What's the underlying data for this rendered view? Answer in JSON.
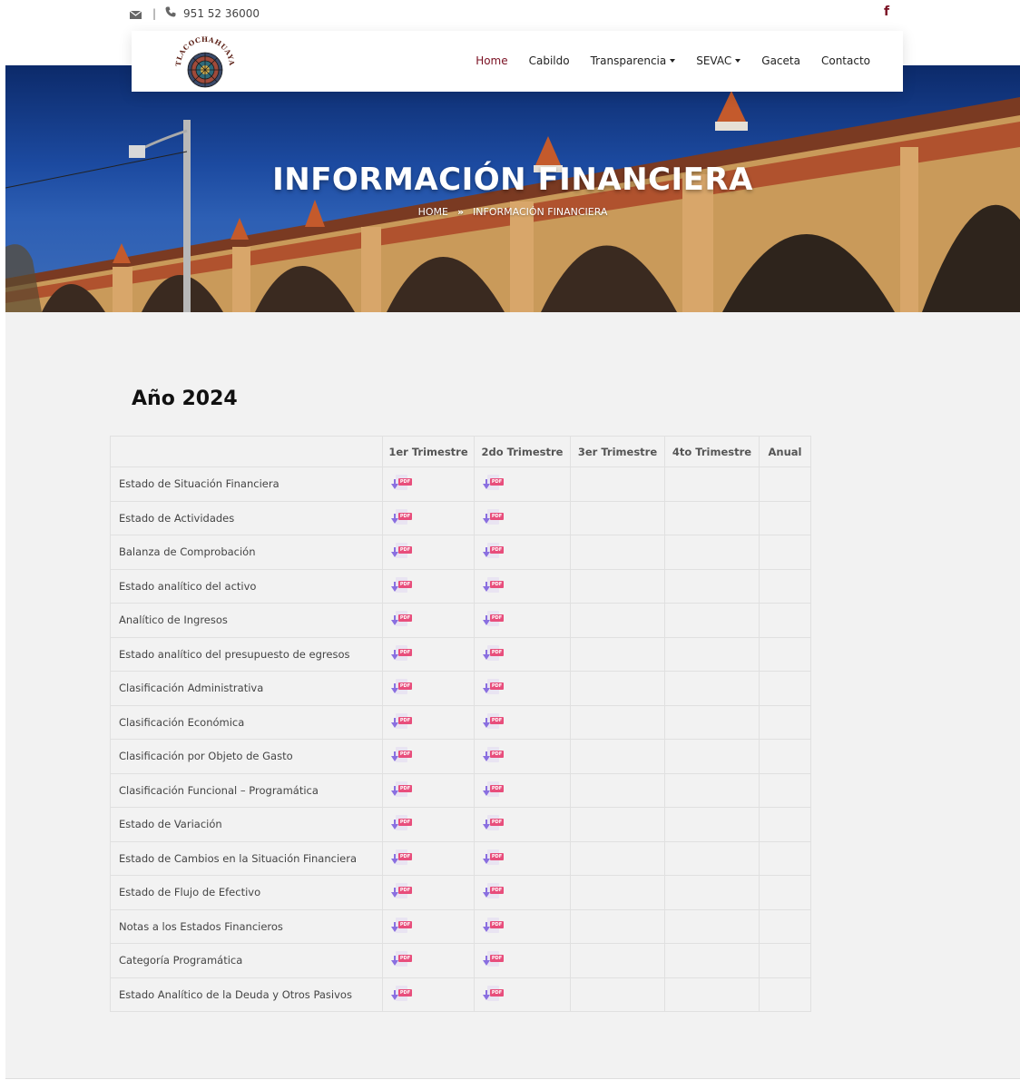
{
  "topbar": {
    "email_icon": "envelope-icon",
    "separator": "|",
    "phone_icon": "phone-icon",
    "phone": "951 52 36000",
    "social_icon": "facebook-icon",
    "social_glyph": "f"
  },
  "logo": {
    "alt_text": "TLACOCHAHUAYA"
  },
  "nav": {
    "items": [
      {
        "label": "Home",
        "active": true,
        "dropdown": false
      },
      {
        "label": "Cabildo",
        "active": false,
        "dropdown": false
      },
      {
        "label": "Transparencia",
        "active": false,
        "dropdown": true
      },
      {
        "label": "SEVAC",
        "active": false,
        "dropdown": true
      },
      {
        "label": "Gaceta",
        "active": false,
        "dropdown": false
      },
      {
        "label": "Contacto",
        "active": false,
        "dropdown": false
      }
    ]
  },
  "hero": {
    "title": "INFORMACIÓN FINANCIERA",
    "breadcrumb_home": "HOME",
    "breadcrumb_sep": "»",
    "breadcrumb_current": "INFORMACIÓN FINANCIERA"
  },
  "section": {
    "title": "Año 2024"
  },
  "table": {
    "headers": [
      "",
      "1er Trimestre",
      "2do Trimestre",
      "3er Trimestre",
      "4to Trimestre",
      "Anual"
    ],
    "pdf_label": "PDF",
    "rows": [
      {
        "label": "Estado de Situación Financiera",
        "files": [
          true,
          true,
          false,
          false,
          false
        ]
      },
      {
        "label": "Estado de Actividades",
        "files": [
          true,
          true,
          false,
          false,
          false
        ]
      },
      {
        "label": "Balanza de Comprobación",
        "files": [
          true,
          true,
          false,
          false,
          false
        ]
      },
      {
        "label": "Estado analítico del activo",
        "files": [
          true,
          true,
          false,
          false,
          false
        ]
      },
      {
        "label": "Analítico de Ingresos",
        "files": [
          true,
          true,
          false,
          false,
          false
        ]
      },
      {
        "label": "Estado analítico del presupuesto de egresos",
        "files": [
          true,
          true,
          false,
          false,
          false
        ]
      },
      {
        "label": "Clasificación Administrativa",
        "files": [
          true,
          true,
          false,
          false,
          false
        ]
      },
      {
        "label": "Clasificación Económica",
        "files": [
          true,
          true,
          false,
          false,
          false
        ]
      },
      {
        "label": "Clasificación por Objeto de Gasto",
        "files": [
          true,
          true,
          false,
          false,
          false
        ]
      },
      {
        "label": "Clasificación Funcional – Programática",
        "files": [
          true,
          true,
          false,
          false,
          false
        ]
      },
      {
        "label": "Estado de Variación",
        "files": [
          true,
          true,
          false,
          false,
          false
        ]
      },
      {
        "label": "Estado de Cambios en la Situación Financiera",
        "files": [
          true,
          true,
          false,
          false,
          false
        ]
      },
      {
        "label": "Estado de Flujo de Efectivo",
        "files": [
          true,
          true,
          false,
          false,
          false
        ]
      },
      {
        "label": "Notas a los Estados Financieros",
        "files": [
          true,
          true,
          false,
          false,
          false
        ]
      },
      {
        "label": "Categoría Programática",
        "files": [
          true,
          true,
          false,
          false,
          false
        ]
      },
      {
        "label": "Estado Analítico de la Deuda y Otros Pasivos",
        "files": [
          true,
          true,
          false,
          false,
          false
        ]
      }
    ]
  },
  "colors": {
    "brand": "#7a1022",
    "pdf_tag": "#e84e7c",
    "download_arrow": "#8a6fe0",
    "main_bg": "#f2f2f2"
  }
}
